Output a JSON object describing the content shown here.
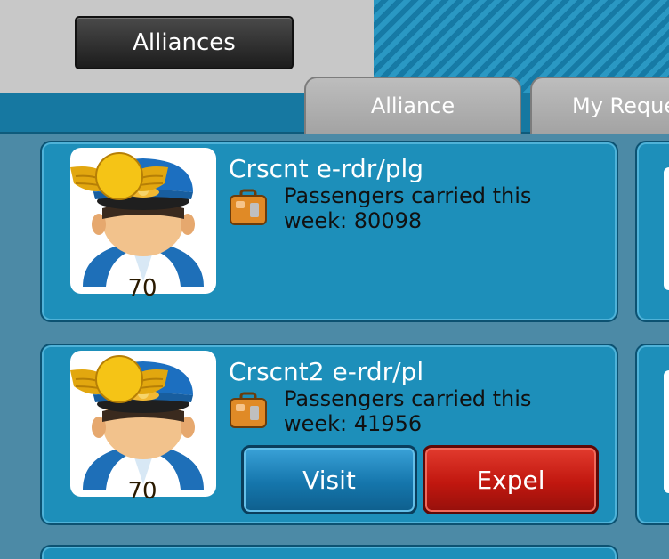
{
  "header": {
    "title_button": "Alliances"
  },
  "tabs": [
    {
      "label": "Alliance"
    },
    {
      "label": "My Reque"
    }
  ],
  "members": [
    {
      "name": "Crscnt e-rdr/plg",
      "level": "70",
      "stat_text": "Passengers carried this week: 80098"
    },
    {
      "name": "Crscnt2 e-rdr/pl",
      "level": "70",
      "stat_text": "Passengers carried this week: 41956",
      "visit_label": "Visit",
      "expel_label": "Expel"
    }
  ],
  "colors": {
    "panel_blue": "#1d8fba",
    "visit_button": "#1576ac",
    "expel_button": "#c1170f",
    "badge_gold": "#f5c416"
  }
}
